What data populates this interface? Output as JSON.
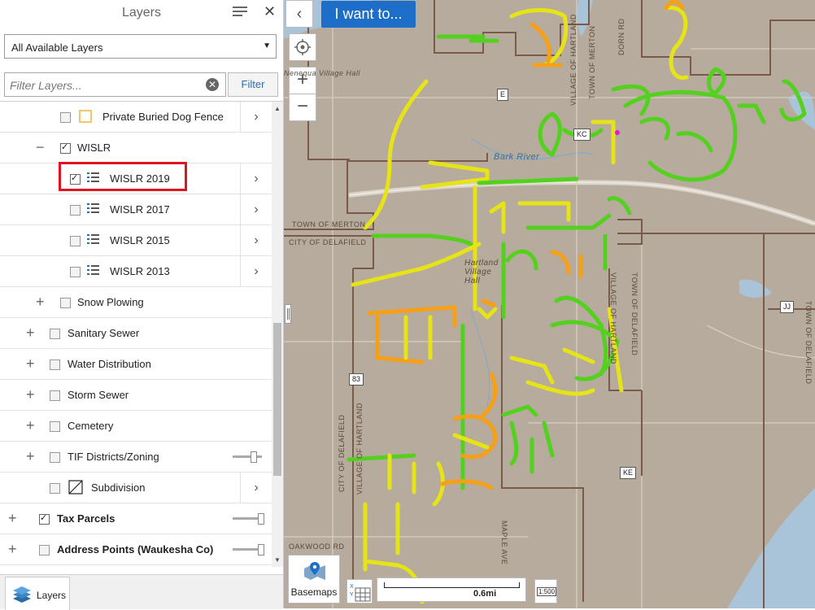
{
  "panel": {
    "title": "Layers",
    "layer_select": "All Available Layers",
    "filter_placeholder": "Filter Layers...",
    "filter_button": "Filter",
    "footer_tab": "Layers"
  },
  "layers": [
    {
      "label": "Private Buried Dog Fence",
      "checked": false
    },
    {
      "label": "WISLR",
      "checked": true
    },
    {
      "label": "WISLR 2019",
      "checked": true
    },
    {
      "label": "WISLR 2017",
      "checked": false
    },
    {
      "label": "WISLR 2015",
      "checked": false
    },
    {
      "label": "WISLR 2013",
      "checked": false
    },
    {
      "label": "Snow Plowing",
      "checked": false
    },
    {
      "label": "Sanitary Sewer",
      "checked": false
    },
    {
      "label": "Water Distribution",
      "checked": false
    },
    {
      "label": "Storm Sewer",
      "checked": false
    },
    {
      "label": "Cemetery",
      "checked": false
    },
    {
      "label": "TIF Districts/Zoning",
      "checked": false
    },
    {
      "label": "Subdivision",
      "checked": false
    },
    {
      "label": "Tax Parcels",
      "checked": true
    },
    {
      "label": "Address Points (Waukesha Co)",
      "checked": false
    }
  ],
  "map": {
    "i_want_to": "I want to...",
    "basemaps": "Basemaps",
    "scale_label": "0.6mi",
    "scale_ratio": "1:500",
    "labels": {
      "town_merton_1": "TOWN OF MERTON",
      "city_delafield_1": "CITY OF DELAFIELD",
      "village_hartland_top": "VILLAGE OF HARTLAND",
      "town_merton_top": "TOWN OF MERTON",
      "dorn_rd": "DORN RD",
      "bark_river": "Bark River",
      "hartland_village_hall": "Hartland Village Hall",
      "nenequa_hall": "Nenequa Village Hall",
      "town_delafield_1": "TOWN OF DELAFIELD",
      "town_delafield_2": "TOWN OF DELAFIELD",
      "village_hartland_mid": "VILLAGE OF HARTLAND",
      "city_delafield_2": "CITY OF DELAFIELD",
      "village_hartland_low": "VILLAGE OF HARTLAND",
      "maple_ave": "MAPLE AVE",
      "oakwood": "OAKWOOD RD"
    },
    "shields": {
      "e": "E",
      "kc": "KC",
      "jj": "JJ",
      "hwy83": "83",
      "ke": "KE"
    },
    "colors": {
      "good": "#54d11e",
      "fair": "#e6e317",
      "poor": "#f5a017",
      "boundary": "#7b5a4a",
      "map_bg": "#b6ab9d",
      "button_blue": "#1c6ec9",
      "highlight": "#e0141e"
    }
  }
}
